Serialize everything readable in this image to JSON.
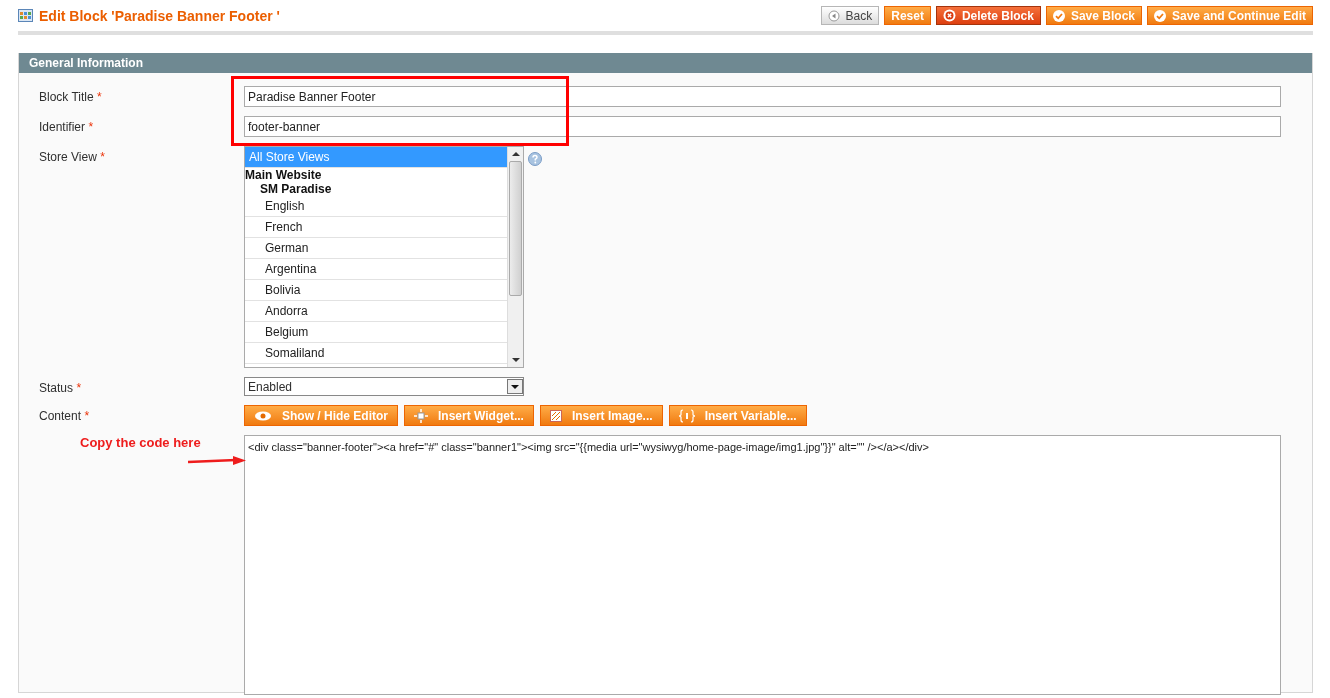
{
  "header": {
    "title": "Edit Block 'Paradise Banner Footer '"
  },
  "actions": [
    {
      "label": "Back",
      "kind": "back"
    },
    {
      "label": "Reset",
      "kind": "plain"
    },
    {
      "label": "Delete Block",
      "kind": "delete"
    },
    {
      "label": "Save Block",
      "kind": "save"
    },
    {
      "label": "Save and Continue Edit",
      "kind": "save"
    }
  ],
  "section": {
    "title": "General Information"
  },
  "fields": {
    "block_title": {
      "label": "Block Title",
      "required": "*",
      "value": "Paradise Banner Footer"
    },
    "identifier": {
      "label": "Identifier",
      "required": "*",
      "value": "footer-banner"
    },
    "store_view": {
      "label": "Store View",
      "required": "*",
      "options": [
        {
          "label": "All Store Views",
          "selected": true
        },
        {
          "label": "Main Website",
          "children": [
            {
              "label": "SM Paradise",
              "children": [
                {
                  "label": "English",
                  "selected": false
                },
                {
                  "label": "French",
                  "selected": false
                },
                {
                  "label": "German",
                  "selected": false
                },
                {
                  "label": "Argentina",
                  "selected": false
                },
                {
                  "label": "Bolivia",
                  "selected": false
                },
                {
                  "label": "Andorra",
                  "selected": false
                },
                {
                  "label": "Belgium",
                  "selected": false
                },
                {
                  "label": "Somaliland",
                  "selected": false
                }
              ]
            }
          ]
        }
      ]
    },
    "status": {
      "label": "Status",
      "required": "*",
      "value": "Enabled"
    },
    "content": {
      "label": "Content",
      "required": "*",
      "toolbar": [
        {
          "label": "Show / Hide Editor",
          "kind": "eye"
        },
        {
          "label": "Insert Widget...",
          "kind": "widget"
        },
        {
          "label": "Insert Image...",
          "kind": "image"
        },
        {
          "label": "Insert Variable...",
          "kind": "variable"
        }
      ],
      "value": "<div class=\"banner-footer\"><a href=\"#\" class=\"banner1\"><img src=\"{{media url=\"wysiwyg/home-page-image/img1.jpg\"}}\" alt=\"\" /></a></div>"
    }
  },
  "annotation": {
    "note": "Copy the code here"
  }
}
